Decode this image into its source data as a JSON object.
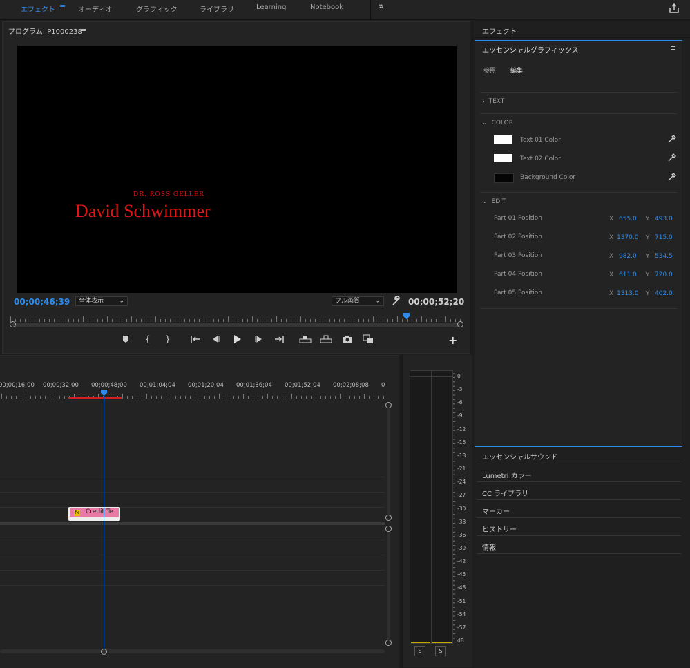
{
  "workspaces": {
    "tabs": [
      {
        "label": "エフェクト",
        "active": true
      },
      {
        "label": "オーディオ"
      },
      {
        "label": "グラフィック"
      },
      {
        "label": "ライブラリ"
      },
      {
        "label": "Learning"
      },
      {
        "label": "Notebook"
      }
    ],
    "more_icon": "double-chevron-right-icon",
    "share_icon": "share-icon"
  },
  "program": {
    "title": "プログラム: P1000238",
    "preview_subtitle": "DR. ROSS GELLER",
    "preview_name": "David Schwimmer",
    "title_color": "#e01515",
    "timecode_current": "00;00;46;39",
    "zoom": "全体表示",
    "quality": "フル画質",
    "timecode_duration": "00;00;52;20",
    "playhead_fraction": 0.88
  },
  "transport": {
    "icons": [
      "marker-icon",
      "mark-in-icon",
      "mark-out-icon",
      "go-to-in-icon",
      "step-back-icon",
      "play-icon",
      "step-forward-icon",
      "go-to-out-icon",
      "lift-icon",
      "extract-icon",
      "export-frame-icon",
      "compare-icon"
    ],
    "add_icon": "plus-icon"
  },
  "timeline": {
    "ticks": [
      "00;00;16;00",
      "00;00;32;00",
      "00;00;48;00",
      "00;01;04;04",
      "00;01;20;04",
      "00;01;36;04",
      "00;01;52;04",
      "00;02;08;08",
      "0"
    ],
    "clip_label": "Credit Te",
    "clip_color": "#e87aa5",
    "fx_badge": "fx"
  },
  "audio_meter": {
    "scale": [
      "0",
      "-3",
      "-6",
      "-9",
      "-12",
      "-15",
      "-18",
      "-21",
      "-24",
      "-27",
      "-30",
      "-33",
      "-36",
      "-39",
      "-42",
      "-45",
      "-48",
      "-51",
      "-54",
      "-57",
      "dB"
    ],
    "solo_labels": [
      "S",
      "S"
    ]
  },
  "right": {
    "effects_title": "エフェクト",
    "eg_title": "エッセンシャルグラフィックス",
    "tabs": [
      {
        "label": "参照"
      },
      {
        "label": "編集",
        "active": true
      }
    ],
    "sections": {
      "text": "TEXT",
      "color": "COLOR",
      "edit": "EDIT"
    },
    "colors": [
      {
        "label": "Text 01 Color",
        "value": "#ffffff"
      },
      {
        "label": "Text 02 Color",
        "value": "#ffffff"
      },
      {
        "label": "Background Color",
        "value": "#050505"
      }
    ],
    "positions": [
      {
        "label": "Part 01 Position",
        "x": "655.0",
        "y": "493.0"
      },
      {
        "label": "Part 02 Position",
        "x": "1370.0",
        "y": "715.0"
      },
      {
        "label": "Part 03 Position",
        "x": "982.0",
        "y": "534.5"
      },
      {
        "label": "Part 04 Position",
        "x": "611.0",
        "y": "720.0"
      },
      {
        "label": "Part 05 Position",
        "x": "1313.0",
        "y": "402.0"
      }
    ],
    "x_label": "X",
    "y_label": "Y",
    "panels": [
      "エッセンシャルサウンド",
      "Lumetri カラー",
      "CC ライブラリ",
      "マーカー",
      "ヒストリー",
      "情報"
    ]
  }
}
